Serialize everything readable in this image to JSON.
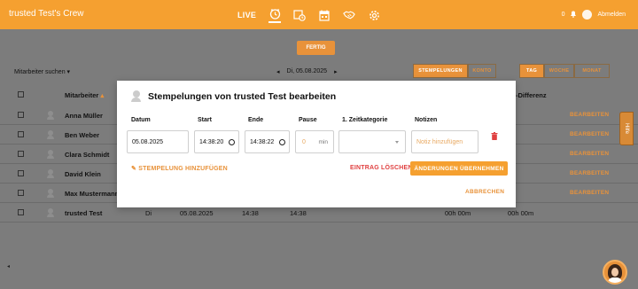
{
  "app": {
    "title": "trusted Test's Crew"
  },
  "topnav": {
    "live": "LIVE",
    "icons": [
      "clock-icon",
      "clock-history-icon",
      "calendar-icon",
      "handshake-icon",
      "gear-icon"
    ],
    "notif_count": "0",
    "logout": "Abmelden"
  },
  "toolbar": {
    "fertig": "FERTIG",
    "filter": "Mitarbeiter suchen",
    "date_prev": "◂",
    "date": "Di, 05.08.2025",
    "date_next": "▸",
    "view1": [
      "STEMPELUNGEN",
      "KONTO"
    ],
    "view2": [
      "TAG",
      "WOCHE",
      "MONAT"
    ]
  },
  "table": {
    "col_employee": "Mitarbeiter",
    "col_diff": "-Differenz",
    "edit_label": "BEARBEITEN",
    "rows": [
      {
        "name": "Anna Müller"
      },
      {
        "name": "Ben Weber"
      },
      {
        "name": "Clara Schmidt"
      },
      {
        "name": "David Klein"
      },
      {
        "name": "Max Mustermann"
      },
      {
        "name": "trusted Test",
        "day": "Di",
        "date": "05.08.2025",
        "start": "14:38",
        "end": "14:38",
        "v1": "00h 00m",
        "v2": "00h 00m"
      }
    ]
  },
  "side_tab": "Hilfe",
  "modal": {
    "title": "Stempelungen von trusted Test bearbeiten",
    "labels": {
      "datum": "Datum",
      "start": "Start",
      "ende": "Ende",
      "pause": "Pause",
      "kategorie": "1. Zeitkategorie",
      "notizen": "Notizen"
    },
    "values": {
      "datum": "05.08.2025",
      "start": "14:38:20",
      "ende": "14:38:22",
      "pause": "0",
      "pause_unit": "min",
      "kategorie": "",
      "notizen_placeholder": "Notiz hinzufügen"
    },
    "add_link": "STEMPELUNG HINZUFÜGEN",
    "delete_link": "EINTRAG LÖSCHEN",
    "apply_button": "ÄNDERUNGEN ÜBERNEHMEN",
    "cancel": "ABBRECHEN"
  },
  "colors": {
    "brand": "#f5a030",
    "danger": "#e04040"
  }
}
